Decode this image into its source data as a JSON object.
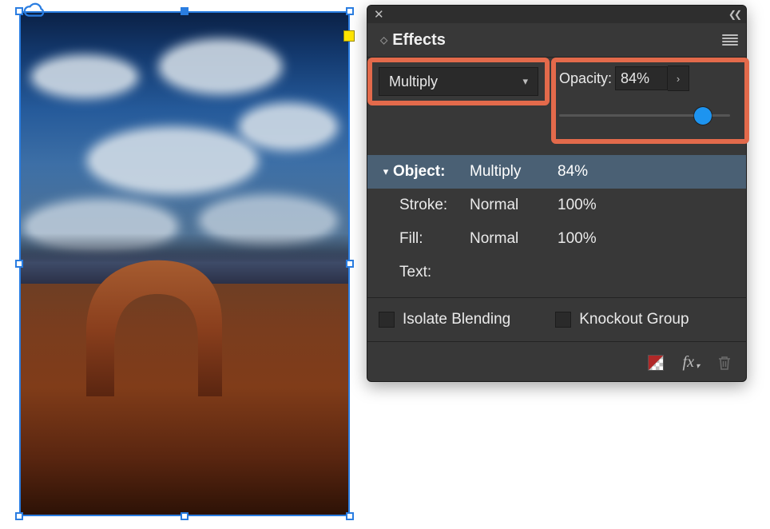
{
  "panel": {
    "title": "Effects",
    "blend_mode": "Multiply",
    "opacity": {
      "label": "Opacity:",
      "value_text": "84%",
      "value": 84
    },
    "rows": {
      "object": {
        "label": "Object:",
        "mode": "Multiply",
        "opacity": "84%"
      },
      "stroke": {
        "label": "Stroke:",
        "mode": "Normal",
        "opacity": "100%"
      },
      "fill": {
        "label": "Fill:",
        "mode": "Normal",
        "opacity": "100%"
      },
      "text": {
        "label": "Text:",
        "mode": "",
        "opacity": ""
      }
    },
    "checks": {
      "isolate": {
        "label": "Isolate Blending",
        "checked": false
      },
      "knockout": {
        "label": "Knockout Group",
        "checked": false
      }
    },
    "highlights": {
      "accent_color": "#e36a4b",
      "blend_mode_control": true,
      "opacity_control": true
    }
  }
}
